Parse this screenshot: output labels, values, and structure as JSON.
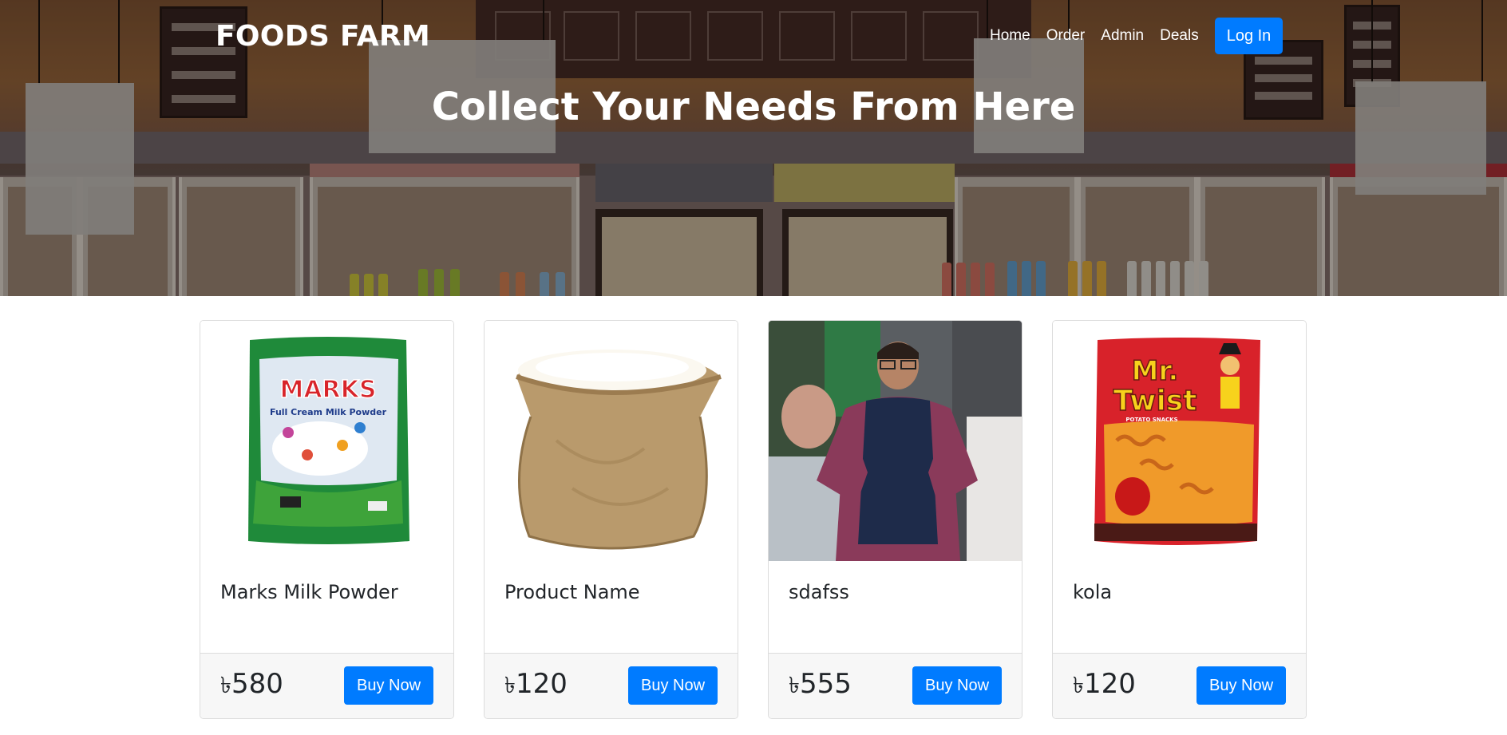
{
  "header": {
    "brand": "FOODS FARM",
    "nav": [
      {
        "label": "Home"
      },
      {
        "label": "Order"
      },
      {
        "label": "Admin"
      },
      {
        "label": "Deals"
      }
    ],
    "login_label": "Log In",
    "hero_title": "Collect Your Needs From Here"
  },
  "products": [
    {
      "name": "Marks Milk Powder",
      "currency": "৳",
      "price": "580",
      "buy_label": "Buy Now",
      "image": "milk-powder-pack",
      "pack_brand": "MARKS",
      "pack_sub": "Full Cream Milk Powder"
    },
    {
      "name": "Product Name",
      "currency": "৳",
      "price": "120",
      "buy_label": "Buy Now",
      "image": "rice-sack"
    },
    {
      "name": "sdafss",
      "currency": "৳",
      "price": "555",
      "buy_label": "Buy Now",
      "image": "person-photo"
    },
    {
      "name": "kola",
      "currency": "৳",
      "price": "120",
      "buy_label": "Buy Now",
      "image": "snack-pack",
      "pack_brand_line1": "Mr.",
      "pack_brand_line2": "Twist",
      "pack_sub": "POTATO SNACKS"
    }
  ],
  "colors": {
    "primary": "#007bff",
    "card_footer": "#f7f7f7",
    "border": "#dcdcdc"
  }
}
